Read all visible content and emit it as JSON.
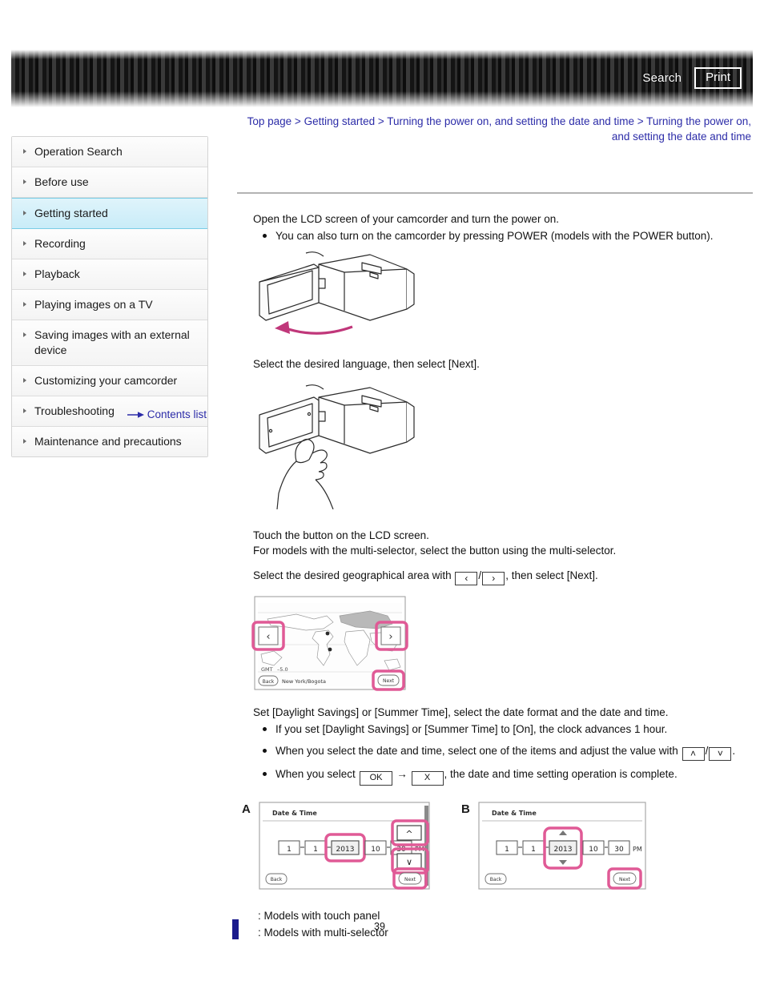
{
  "header": {
    "search_label": "Search",
    "print_label": "Print"
  },
  "breadcrumb": {
    "items": [
      "Top page",
      "Getting started",
      "Turning the power on, and setting the date and time",
      "Turning the power on, and setting the date and time"
    ],
    "separator": ">"
  },
  "sidebar": {
    "items": [
      {
        "label": "Operation Search",
        "active": false
      },
      {
        "label": "Before use",
        "active": false
      },
      {
        "label": "Getting started",
        "active": true
      },
      {
        "label": "Recording",
        "active": false
      },
      {
        "label": "Playback",
        "active": false
      },
      {
        "label": "Playing images on a TV",
        "active": false
      },
      {
        "label": "Saving images with an external device",
        "active": false
      },
      {
        "label": "Customizing your camcorder",
        "active": false
      },
      {
        "label": "Troubleshooting",
        "active": false
      },
      {
        "label": "Maintenance and precautions",
        "active": false
      }
    ],
    "contents_link": "Contents list"
  },
  "main": {
    "step1": {
      "text": "Open the LCD screen of your camcorder and turn the power on.",
      "bullets": [
        "You can also turn on the camcorder by pressing POWER (models with the POWER button)."
      ]
    },
    "step2": {
      "text": "Select the desired language, then select [Next]."
    },
    "step3": {
      "line1": "Touch the button on the LCD screen.",
      "line2": "For models with the multi-selector, select the button using the multi-selector."
    },
    "step4": {
      "prefix": "Select the desired geographical area with",
      "key_left": "‹",
      "key_sep": "/",
      "key_right": "›",
      "suffix": ", then select [Next]."
    },
    "step5": {
      "text": "Set [Daylight Savings] or [Summer Time], select the date format and the date and time.",
      "bullet1": "If you set [Daylight Savings] or [Summer Time] to [On], the clock advances 1 hour.",
      "bullet2_prefix": "When you select the date and time, select one of the items and adjust the value with",
      "bullet2_key_up": "˄",
      "bullet2_sep": "/",
      "bullet2_key_down": "˅",
      "bullet2_suffix": ".",
      "bullet3_prefix": "When you select",
      "bullet3_key_ok": "OK",
      "bullet3_arrow": "→",
      "bullet3_key_x": "X",
      "bullet3_suffix": ", the date and time setting operation is complete."
    },
    "legend": [
      ": Models with touch panel",
      ": Models with multi-selector"
    ]
  },
  "map_screen": {
    "gmt_label": "GMT",
    "gmt_offset": "–5.0",
    "back_label": "Back",
    "area_label": "New York/Bogota",
    "next_label": "Next",
    "left_arrow": "‹",
    "right_arrow": "›"
  },
  "datetime_screens": [
    {
      "letter": "A",
      "title": "Date & Time",
      "fields": [
        "1",
        "1",
        "2013",
        "10",
        "30"
      ],
      "ampm": "PM",
      "back_label": "Back",
      "next_label": "Next",
      "up_arrow": "˄",
      "down_arrow": "˅",
      "selector_style": "side-buttons"
    },
    {
      "letter": "B",
      "title": "Date & Time",
      "fields": [
        "1",
        "1",
        "2013",
        "10",
        "30"
      ],
      "ampm": "PM",
      "back_label": "Back",
      "next_label": "Next",
      "selector_style": "inline-triangles"
    }
  ],
  "footer": {
    "page_number": "39"
  },
  "colors": {
    "link": "#2c2ca8",
    "highlight_pink": "#e05a96",
    "active_nav": "#c9ecf8",
    "banner_dark": "#141414"
  }
}
